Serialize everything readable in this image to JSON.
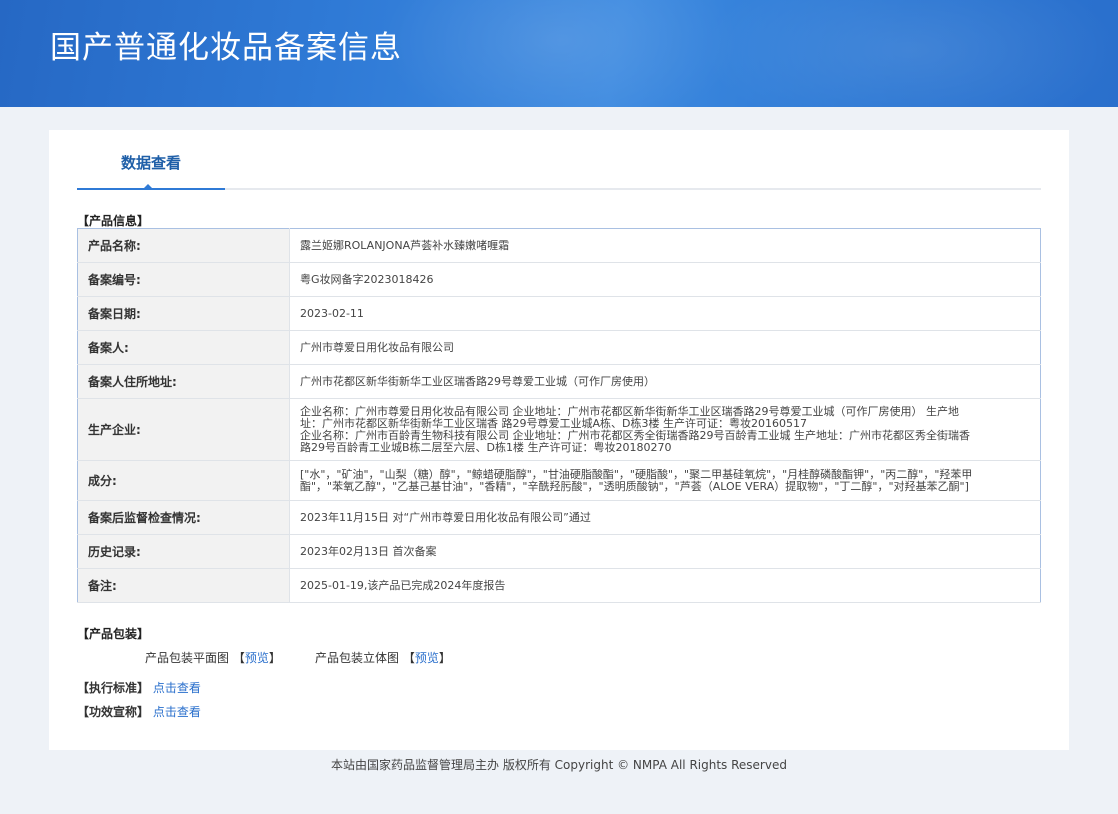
{
  "header": {
    "title": "国产普通化妆品备案信息"
  },
  "tabs": [
    {
      "label": "数据查看"
    }
  ],
  "product_info": {
    "section_title": "【产品信息】",
    "rows": [
      {
        "label": "产品名称:",
        "value": "露兰姬娜ROLANJONA芦荟补水臻嫩啫喱霜"
      },
      {
        "label": "备案编号:",
        "value": "粤G妆网备字2023018426"
      },
      {
        "label": "备案日期:",
        "value": "2023-02-11"
      },
      {
        "label": "备案人:",
        "value": "广州市尊爱日用化妆品有限公司"
      },
      {
        "label": "备案人住所地址:",
        "value": "广州市花都区新华街新华工业区瑞香路29号尊爱工业城（可作厂房使用）"
      },
      {
        "label": "生产企业:",
        "value_lines": [
          "企业名称：广州市尊爱日用化妆品有限公司 企业地址：广州市花都区新华街新华工业区瑞香路29号尊爱工业城（可作厂房使用） 生产地",
          "址：广州市花都区新华街新华工业区瑞香 路29号尊爱工业城A栋、D栋3楼 生产许可证：粤妆20160517",
          "企业名称：广州市百龄青生物科技有限公司 企业地址：广州市花都区秀全街瑞香路29号百龄青工业城 生产地址：广州市花都区秀全街瑞香",
          "路29号百龄青工业城B栋二层至六层、D栋1楼 生产许可证：粤妆20180270"
        ]
      },
      {
        "label": "成分:",
        "value_lines": [
          "[\"水\"，\"矿油\"，\"山梨（糖）醇\"，\"鲸蜡硬脂醇\"，\"甘油硬脂酸酯\"，\"硬脂酸\"，\"聚二甲基硅氧烷\"，\"月桂醇磷酸酯钾\"，\"丙二醇\"，\"羟苯甲",
          "酯\"，\"苯氧乙醇\"，\"乙基己基甘油\"，\"香精\"，\"辛酰羟肟酸\"，\"透明质酸钠\"，\"芦荟（ALOE VERA）提取物\"，\"丁二醇\"，\"对羟基苯乙酮\"]"
        ]
      },
      {
        "label": "备案后监督检查情况:",
        "value": "2023年11月15日 对“广州市尊爱日用化妆品有限公司”通过"
      },
      {
        "label": "历史记录:",
        "value": "2023年02月13日 首次备案"
      },
      {
        "label": "备注:",
        "value": "2025-01-19,该产品已完成2024年度报告"
      }
    ]
  },
  "packaging": {
    "section_title": "【产品包装】",
    "flat_label": "产品包装平面图",
    "solid_label": "产品包装立体图",
    "preview_text": "预览",
    "bracket_open": "【",
    "bracket_close": "】"
  },
  "standard": {
    "section_title": "【执行标准】",
    "link": "点击查看"
  },
  "efficacy": {
    "section_title": "【功效宣称】",
    "link": "点击查看"
  },
  "footer": {
    "text": "本站由国家药品监督管理局主办 版权所有 Copyright © NMPA All Rights Reserved"
  },
  "colors": {
    "banner": "#2f7ad6",
    "link": "#2a6fcc",
    "table_border": "#a9c0e2"
  }
}
